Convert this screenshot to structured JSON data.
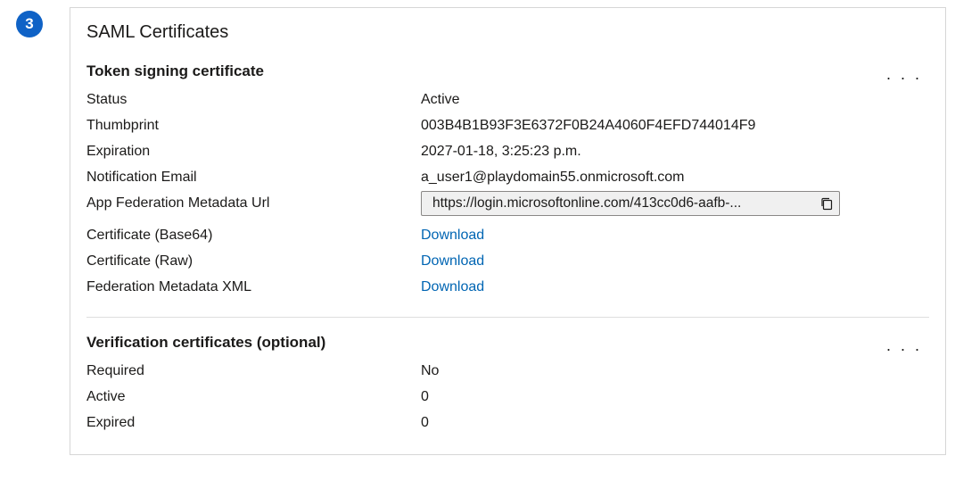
{
  "step": "3",
  "card_title": "SAML Certificates",
  "signing": {
    "heading": "Token signing certificate",
    "status_label": "Status",
    "status": "Active",
    "thumbprint_label": "Thumbprint",
    "thumbprint": "003B4B1B93F3E6372F0B24A4060F4EFD744014F9",
    "expiration_label": "Expiration",
    "expiration": "2027-01-18, 3:25:23 p.m.",
    "email_label": "Notification Email",
    "email": "a_user1@playdomain55.onmicrosoft.com",
    "metadata_label": "App Federation Metadata Url",
    "metadata_url": "https://login.microsoftonline.com/413cc0d6-aafb-...",
    "cert_b64_label": "Certificate (Base64)",
    "cert_raw_label": "Certificate (Raw)",
    "fed_xml_label": "Federation Metadata XML",
    "download": "Download"
  },
  "verification": {
    "heading": "Verification certificates (optional)",
    "required_label": "Required",
    "required": "No",
    "active_label": "Active",
    "active": "0",
    "expired_label": "Expired",
    "expired": "0"
  }
}
